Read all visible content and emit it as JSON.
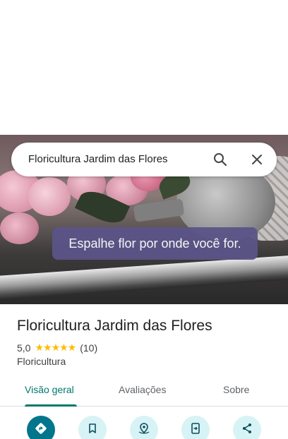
{
  "search": {
    "query": "Floricultura Jardim das Flores"
  },
  "hero": {
    "caption": "Espalhe flor por onde você for."
  },
  "place": {
    "name": "Floricultura Jardim das Flores",
    "rating": "5,0",
    "stars": "★★★★★",
    "review_count": "(10)",
    "category": "Floricultura"
  },
  "tabs": [
    {
      "label": "Visão geral",
      "active": true
    },
    {
      "label": "Avaliações",
      "active": false
    },
    {
      "label": "Sobre",
      "active": false
    }
  ],
  "actions": [
    {
      "icon": "directions-icon"
    },
    {
      "icon": "bookmark-icon"
    },
    {
      "icon": "nearby-icon"
    },
    {
      "icon": "send-to-phone-icon"
    },
    {
      "icon": "share-icon"
    }
  ],
  "colors": {
    "accent": "#00796b",
    "action_primary": "#00758c",
    "action_secondary": "#d7f3f6",
    "star": "#fbbc04",
    "caption_bg": "#5b5488"
  }
}
